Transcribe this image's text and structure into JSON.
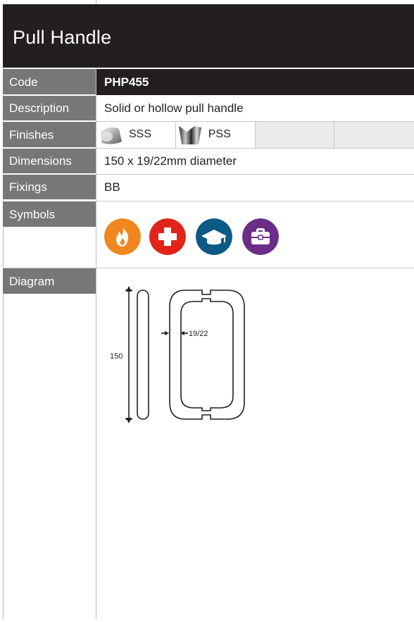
{
  "header": {
    "title": "Pull Handle"
  },
  "rows": {
    "code": {
      "label": "Code",
      "value": "PHP455"
    },
    "description": {
      "label": "Description",
      "value": "Solid or hollow pull handle"
    },
    "finishes": {
      "label": "Finishes",
      "items": [
        {
          "name": "SSS",
          "swatch": "satin-stainless-steel-swatch"
        },
        {
          "name": "PSS",
          "swatch": "polished-stainless-steel-swatch"
        }
      ]
    },
    "dimensions": {
      "label": "Dimensions",
      "value": "150 x 19/22mm diameter"
    },
    "fixings": {
      "label": "Fixings",
      "value": "BB"
    },
    "symbols": {
      "label": "Symbols",
      "icons": [
        {
          "name": "fire-icon",
          "color": "#f0861e"
        },
        {
          "name": "medical-cross-icon",
          "color": "#e2231a"
        },
        {
          "name": "graduation-cap-icon",
          "color": "#0b5a85"
        },
        {
          "name": "briefcase-icon",
          "color": "#6b2d86"
        }
      ]
    },
    "diagram": {
      "label": "Diagram",
      "dimension_height": "150",
      "dimension_diameter": "19/22"
    }
  },
  "colors": {
    "header_bg": "#231f20",
    "label_bg": "#777777",
    "empty_finish_bg": "#ebebeb"
  }
}
